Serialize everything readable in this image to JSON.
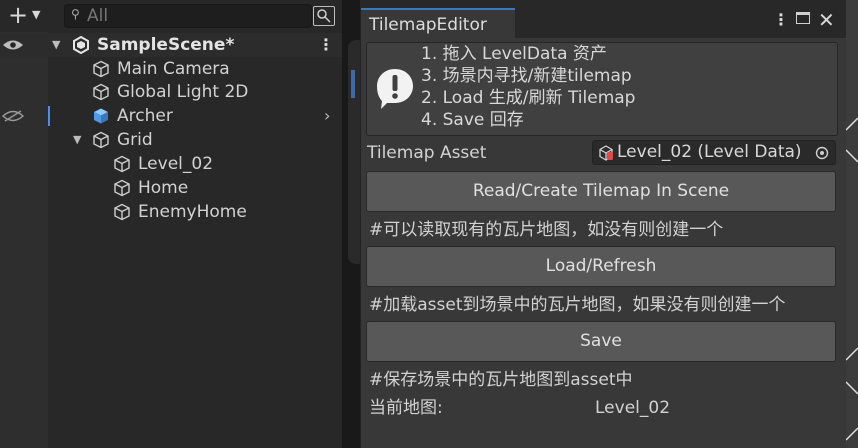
{
  "hierarchy": {
    "search": {
      "placeholder": "All"
    },
    "scene_name": "SampleScene*",
    "items": [
      {
        "label": "Main Camera"
      },
      {
        "label": "Global Light 2D"
      },
      {
        "label": "Archer"
      },
      {
        "label": "Grid"
      },
      {
        "label": "Level_02"
      },
      {
        "label": "Home"
      },
      {
        "label": "EnemyHome"
      }
    ]
  },
  "editor": {
    "tab_title": "TilemapEditor",
    "help_lines": [
      "1. 拖入 LevelData 资产",
      "3. 场景内寻找/新建tilemap",
      "2. Load 生成/刷新 Tilemap",
      "4. Save 回存"
    ],
    "asset_label": "Tilemap Asset",
    "asset_value": "Level_02 (Level Data)",
    "read_button": "Read/Create Tilemap In Scene",
    "read_hint": "#可以读取现有的瓦片地图，如没有则创建一个",
    "load_button": "Load/Refresh",
    "load_hint": "#加载asset到场景中的瓦片地图，如果没有则创建一个",
    "save_button": "Save",
    "save_hint": "#保存场景中的瓦片地图到asset中",
    "current_map_label": "当前地图:",
    "current_map_value": "Level_02"
  },
  "colors": {
    "accent": "#3a79bb",
    "selection": "#4b8ff4",
    "panel": "#383838",
    "button": "#585858"
  },
  "icons": [
    "plus-icon",
    "search-icon",
    "eye-icon",
    "unity-scene-icon",
    "gameobject-cube-icon",
    "prefab-cube-icon",
    "info-icon",
    "kebab-menu-icon",
    "maximize-icon",
    "close-icon",
    "object-picker-icon"
  ]
}
